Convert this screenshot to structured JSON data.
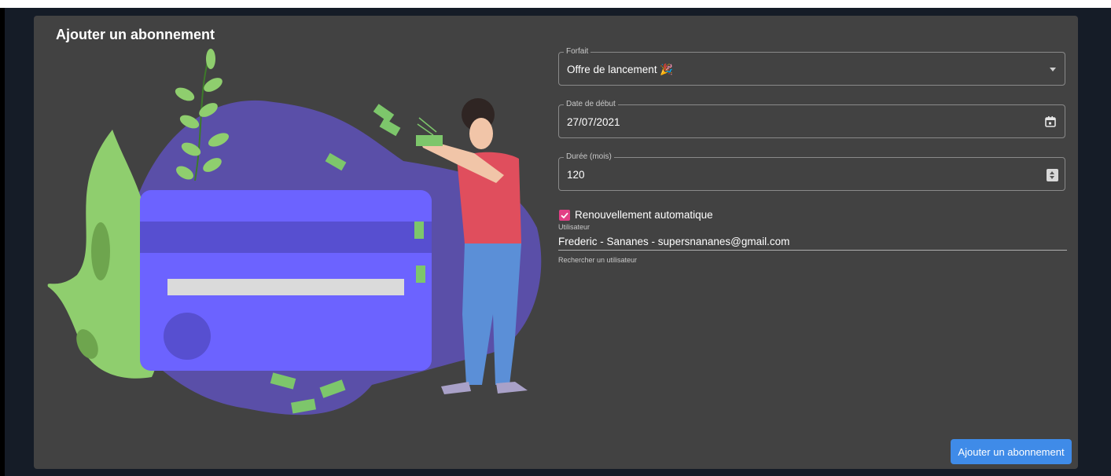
{
  "page": {
    "title": "Ajouter un abonnement"
  },
  "form": {
    "forfait": {
      "label": "Forfait",
      "value": "Offre de lancement 🎉"
    },
    "start_date": {
      "label": "Date de début",
      "value": "27/07/2021"
    },
    "duration": {
      "label": "Durée (mois)",
      "value": "120"
    },
    "auto_renew": {
      "label": "Renouvellement automatique",
      "checked": true
    },
    "user": {
      "caption": "Utilisateur",
      "value": "Frederic - Sananes - supersnananes@gmail.com",
      "helper": "Rechercher un utilisateur"
    },
    "submit_label": "Ajouter un abonnement"
  },
  "icons": {
    "dropdown": "chevron-down-icon",
    "calendar": "calendar-icon",
    "spinner": "number-spinner-icon",
    "checkbox": "checkmark-icon"
  },
  "colors": {
    "background": "#151c27",
    "card": "#424242",
    "accent_button": "#3f8be8",
    "checkbox": "#e23f85",
    "card_illustration": "#6c63ff",
    "blob": "#5a4fa8",
    "plant": "#8fce6e"
  }
}
